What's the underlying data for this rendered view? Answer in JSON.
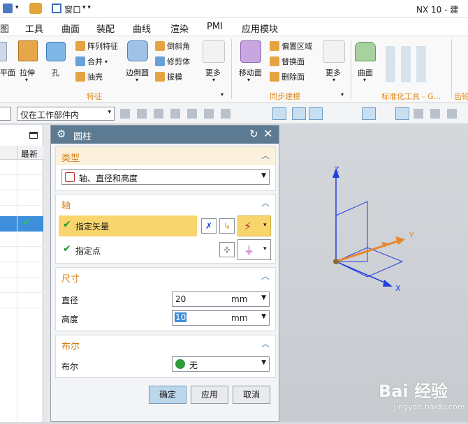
{
  "app_title": "NX 10 - 建",
  "title_menu": {
    "window_label": "窗口"
  },
  "menu_bar": [
    "图",
    "工具",
    "曲面",
    "装配",
    "曲线",
    "渲染",
    "PMI",
    "应用模块"
  ],
  "ribbon": {
    "big_buttons": [
      "平面",
      "拉伸",
      "孔",
      "边倒圆",
      "更多",
      "移动面",
      "更多",
      "曲面"
    ],
    "small_buttons": [
      "阵列特征",
      "合并",
      "抽壳",
      "倒斜角",
      "修剪体",
      "拔模",
      "偏置区域",
      "替换面",
      "删除面"
    ],
    "groups": [
      "特征",
      "同步建模",
      "标准化工具 - G...",
      "齿轮"
    ]
  },
  "toolbar": {
    "scope_select": "仅在工作部件内"
  },
  "left_panel": {
    "latest_header": "最新"
  },
  "dialog": {
    "title": "圆柱",
    "type_section": {
      "label": "类型",
      "value": "轴、直径和高度"
    },
    "axis_section": {
      "label": "轴",
      "vector_label": "指定矢量",
      "point_label": "指定点"
    },
    "dims_section": {
      "label": "尺寸",
      "diameter_label": "直径",
      "diameter_value": "20",
      "diameter_unit": "mm",
      "height_label": "高度",
      "height_value": "10",
      "height_unit": "mm"
    },
    "boolean_section": {
      "label": "布尔",
      "row_label": "布尔",
      "value": "无"
    },
    "buttons": {
      "ok": "确定",
      "apply": "应用",
      "cancel": "取消"
    }
  },
  "viewport": {
    "axis_z": "Z",
    "axis_x": "X",
    "axis_y": "Y"
  },
  "watermark": {
    "brand": "Bai 经验",
    "url": "jingyan.baidu.com"
  },
  "colors": {
    "accent_orange": "#d47b11",
    "dialog_title": "#5c7b92",
    "check_green": "#1f9a2e",
    "axis_blue": "#1f3fe0",
    "vector_orange": "#e8862a"
  }
}
